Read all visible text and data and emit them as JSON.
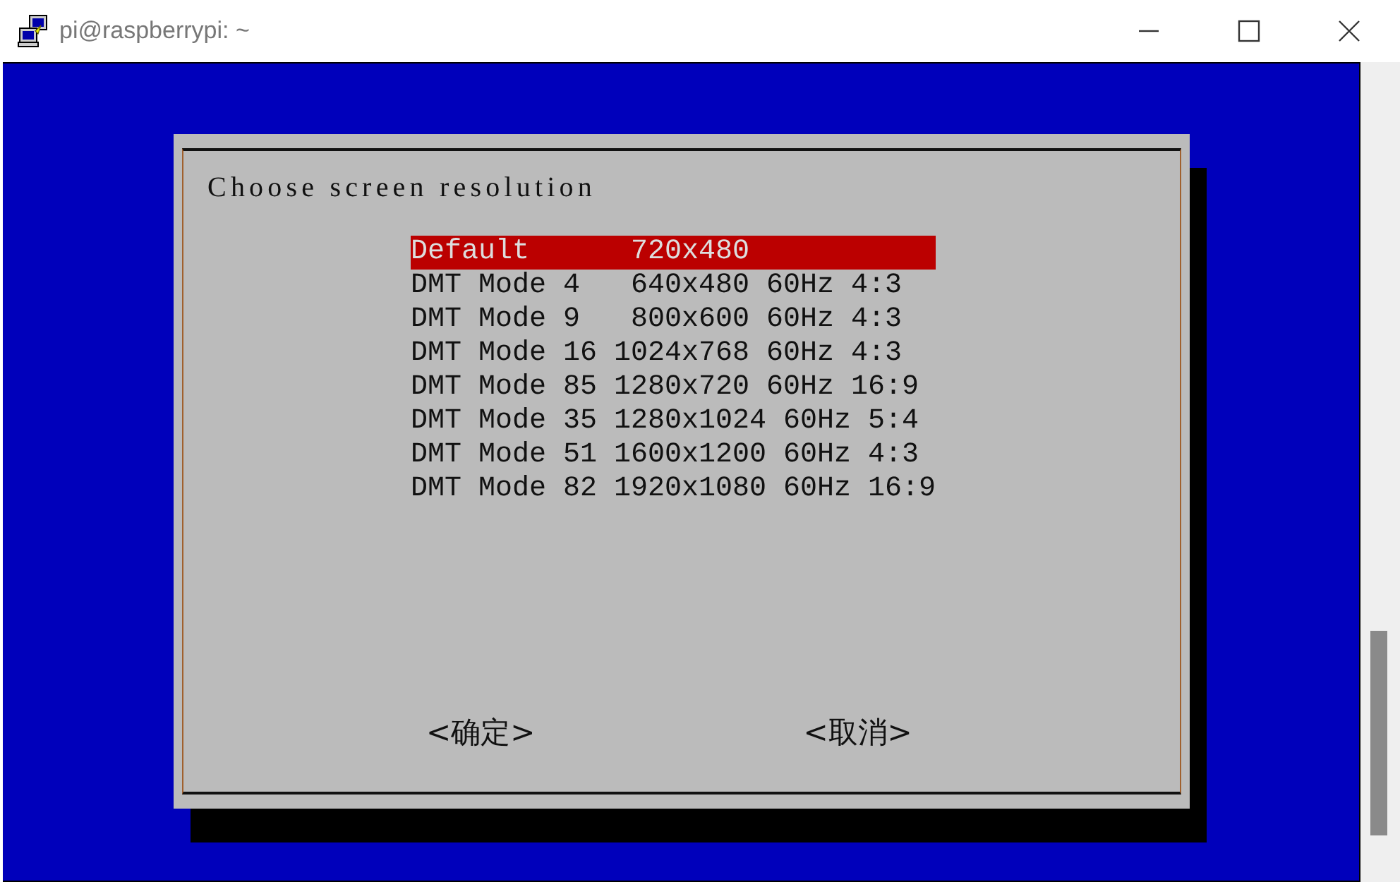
{
  "window": {
    "title": "pi@raspberrypi: ~"
  },
  "dialog": {
    "title": "Choose screen resolution",
    "items": [
      {
        "label": "Default      720x480",
        "selected": true
      },
      {
        "label": "DMT Mode 4   640x480 60Hz 4:3",
        "selected": false
      },
      {
        "label": "DMT Mode 9   800x600 60Hz 4:3",
        "selected": false
      },
      {
        "label": "DMT Mode 16 1024x768 60Hz 4:3",
        "selected": false
      },
      {
        "label": "DMT Mode 85 1280x720 60Hz 16:9",
        "selected": false
      },
      {
        "label": "DMT Mode 35 1280x1024 60Hz 5:4",
        "selected": false
      },
      {
        "label": "DMT Mode 51 1600x1200 60Hz 4:3",
        "selected": false
      },
      {
        "label": "DMT Mode 82 1920x1080 60Hz 16:9",
        "selected": false
      }
    ],
    "buttons": [
      "<确定>",
      "<取消>"
    ]
  }
}
